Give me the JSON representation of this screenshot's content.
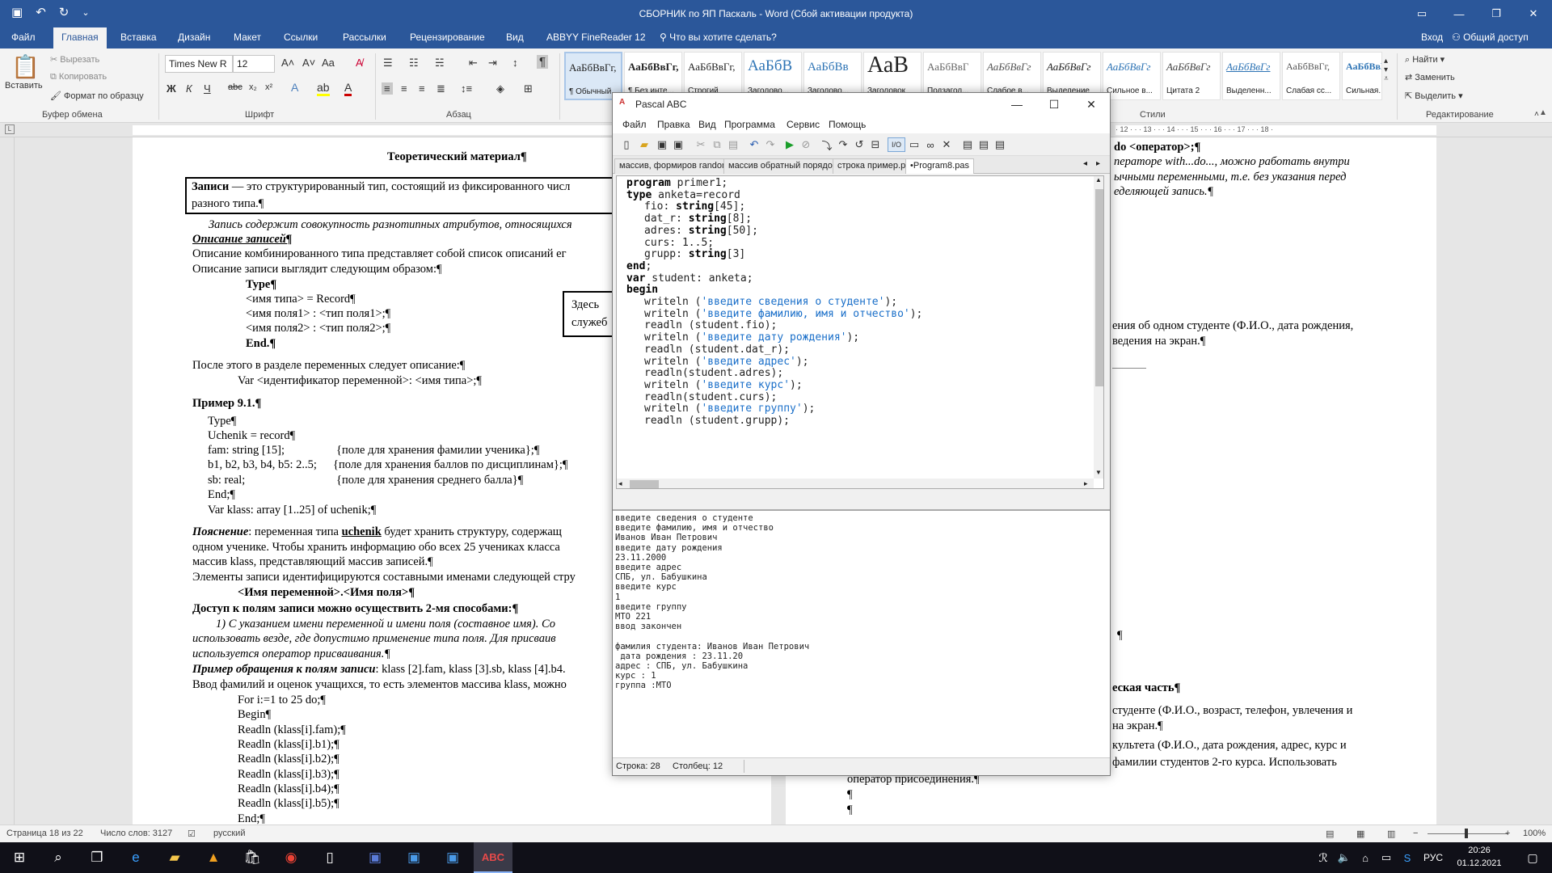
{
  "word": {
    "title": "СБОРНИК по ЯП Паскаль - Word (Сбой активации продукта)",
    "tabs": [
      "Файл",
      "Главная",
      "Вставка",
      "Дизайн",
      "Макет",
      "Ссылки",
      "Рассылки",
      "Рецензирование",
      "Вид",
      "ABBYY FineReader 12"
    ],
    "tell_me": "Что вы хотите сделать?",
    "signin": "Вход",
    "share": "Общий доступ",
    "ribbon": {
      "paste": "Вставить",
      "cut": "Вырезать",
      "copy": "Копировать",
      "format_painter": "Формат по образцу",
      "clipboard_group": "Буфер обмена",
      "font_name": "Times New R",
      "font_size": "12",
      "font_group": "Шрифт",
      "paragraph_group": "Абзац",
      "styles": [
        {
          "sample": "АаБбВвГг,",
          "name": "¶ Обычный"
        },
        {
          "sample": "АаБбВвГг,",
          "name": "¶ Без инте..."
        },
        {
          "sample": "АаБбВвГг,",
          "name": "Строгий"
        },
        {
          "sample": "АаБбВ",
          "name": "Заголово..."
        },
        {
          "sample": "АаБбВв",
          "name": "Заголово..."
        },
        {
          "sample": "АаВ",
          "name": "Заголовок"
        },
        {
          "sample": "АаБбВвГ",
          "name": "Подзагол..."
        },
        {
          "sample": "АаБбВвГг",
          "name": "Слабое в..."
        },
        {
          "sample": "АаБбВвГг",
          "name": "Выделение"
        },
        {
          "sample": "АаБбВвГг",
          "name": "Сильное в..."
        },
        {
          "sample": "АаБбВвГг",
          "name": "Цитата 2"
        },
        {
          "sample": "АаБбВвГг",
          "name": "Выделенн..."
        },
        {
          "sample": "АаБбВвГг,",
          "name": "Слабая сс..."
        },
        {
          "sample": "АаБбВвГг,",
          "name": "Сильная..."
        }
      ],
      "styles_group": "Стили",
      "find": "Найти",
      "replace": "Заменить",
      "select": "Выделить",
      "editing_group": "Редактирование"
    },
    "doc": {
      "heading": "Теоретический материал¶",
      "def1": " — это структурированный тип, состоящий из фиксированного числ",
      "def1_bold": "Записи",
      "def2": "разного типа.¶",
      "l1": "Запись содержит совокупность разнотипных атрибутов, относящихся",
      "l2": "Описание записей¶",
      "l3": "Описание комбинированного типа представляет собой список описаний ег",
      "l4": "Описание записи выглядит следующим образом:¶",
      "l5": "Type¶",
      "l6": "<имя типа> = Record¶",
      "l7": "<имя поля1> : <тип поля1>;¶",
      "l8": "<имя поля2> : <тип поля2>;¶",
      "l9": "End.¶",
      "note1": "Здесь ",
      "note2": "служеб",
      "l10": "После этого в разделе переменных следует описание:¶",
      "l11": "Var <идентификатор переменной>: <имя типа>;¶",
      "l12": "Пример 9.1.¶",
      "l13": "Type¶",
      "l14": "Uchenik = record¶",
      "l15": "fam: string [15];",
      "l15c": "{поле для хранения фамилии ученика};¶",
      "l16": "b1, b2, b3, b4, b5: 2..5;",
      "l16c": "{поле для хранения баллов по дисциплинам};¶",
      "l17": "sb: real;",
      "l17c": "{поле для хранения среднего балла}¶",
      "l18": "End;¶",
      "l19": "Var klass: array [1..25] of uchenik;¶",
      "l20a": "Пояснение",
      "l20b": ": переменная типа ",
      "l20c": "uchenik",
      "l20d": " будет хранить структуру, содержащ",
      "l21": "одном ученике. Чтобы хранить информацию обо всех 25 учениках класса",
      "l22": "массив klass, представляющий массив записей.¶",
      "l23": "Элементы записи идентифицируются составными именами следующей стру",
      "l24": "<Имя переменной>.<Имя поля>¶",
      "l25": "Доступ к полям записи можно осуществить 2-мя способами:¶",
      "l26": "1) С указанием имени переменной и имени поля (составное имя). Со",
      "l27": "использовать везде, где допустимо применение типа поля. Для присваив",
      "l28": "используется оператор присваивания.¶",
      "l29a": "Пример обращения к полям записи",
      "l29b": ": klass [2].fam, klass [3].sb, klass [4].b4.",
      "l30": "Ввод фамилий и оценок учащихся, то есть элементов массива klass, можно",
      "l31": "For i:=1 to 25 do;¶",
      "l32": "Begin¶",
      "l33": "Readln (klass[i].fam);¶",
      "l34": "Readln (klass[i].b1);¶",
      "l35": "Readln (klass[i].b2);¶",
      "l36": "Readln (klass[i].b3);¶",
      "l37": "Readln (klass[i].b4);¶",
      "l38": "Readln (klass[i].b5);¶",
      "l39": "End;¶",
      "r1": "do <оператор>;¶",
      "r2": "ператоре with...do..., можно работать внутри",
      "r3": "ычными переменными, т.е. без указания перед",
      "r4": "еделяющей запись.¶",
      "r5": "ения об одном студенте (Ф.И.О., дата рождения,",
      "r6": "ведения на экран.¶",
      "r7": "¶",
      "r8": "еская часть¶",
      "r9": "студенте (Ф.И.О., возраст, телефон, увлечения и",
      "r10": "на экран.¶",
      "r11": "культета (Ф.И.О., дата рождения, адрес, курс и",
      "r12": "фамилии студентов 2-го курса. Использовать",
      "r13": "оператор присоединения.¶",
      "r14": "¶",
      "r15": "¶"
    },
    "status": {
      "page": "Страница 18 из 22",
      "words": "Число слов: 3127",
      "lang": "русский",
      "zoom": "100%"
    }
  },
  "pascal": {
    "title": "Pascal ABC",
    "menu": [
      "Файл",
      "Правка",
      "Вид",
      "Программа",
      "Сервис",
      "Помощь"
    ],
    "tabs": [
      "массив, формиров random.pas",
      "массив обратный порядок.pas",
      "строка пример.pas",
      "•Program8.pas"
    ],
    "code": [
      {
        "kw": "program",
        "rest": " primer1;",
        "i": 0
      },
      {
        "kw": "type",
        "rest": " anketa=record",
        "i": 0
      },
      {
        "kw": "",
        "rest": "fio: ",
        "kw2": "string",
        "rest2": "[45];",
        "i": 1
      },
      {
        "kw": "",
        "rest": "dat_r: ",
        "kw2": "string",
        "rest2": "[8];",
        "i": 1
      },
      {
        "kw": "",
        "rest": "adres: ",
        "kw2": "string",
        "rest2": "[50];",
        "i": 1
      },
      {
        "kw": "",
        "rest": "curs: 1..5;",
        "i": 1
      },
      {
        "kw": "",
        "rest": "grupp: ",
        "kw2": "string",
        "rest2": "[3]",
        "i": 1
      },
      {
        "kw": "end",
        "rest": ";",
        "i": 0
      },
      {
        "kw": "var",
        "rest": " student: anketa;",
        "i": 0
      },
      {
        "kw": "begin",
        "rest": "",
        "i": 0
      },
      {
        "kw": "",
        "rest": "writeln (",
        "str": "'введите сведения о студенте'",
        "rest2": ");",
        "i": 1
      },
      {
        "kw": "",
        "rest": "writeln (",
        "str": "'введите фамилию, имя и отчество'",
        "rest2": ");",
        "i": 1
      },
      {
        "kw": "",
        "rest": "readln (student.fio);",
        "i": 1
      },
      {
        "kw": "",
        "rest": "writeln (",
        "str": "'введите дату рождения'",
        "rest2": ");",
        "i": 1
      },
      {
        "kw": "",
        "rest": "readln (student.dat_r);",
        "i": 1
      },
      {
        "kw": "",
        "rest": "writeln (",
        "str": "'введите адрес'",
        "rest2": ");",
        "i": 1
      },
      {
        "kw": "",
        "rest": "readln(student.adres);",
        "i": 1
      },
      {
        "kw": "",
        "rest": "writeln (",
        "str": "'введите курс'",
        "rest2": ");",
        "i": 1
      },
      {
        "kw": "",
        "rest": "readln(student.curs);",
        "i": 1
      },
      {
        "kw": "",
        "rest": "writeln (",
        "str": "'введите группу'",
        "rest2": ");",
        "i": 1
      },
      {
        "kw": "",
        "rest": "readln (student.grupp);",
        "i": 1
      }
    ],
    "output": [
      "введите сведения о студенте",
      "введите фамилию, имя и отчество",
      "Иванов Иван Петрович",
      "введите дату рождения",
      "23.11.2000",
      "введите адрес",
      "СПБ, ул. Бабушкина",
      "введите курс",
      "1",
      "введите группу",
      "МТО 221",
      "ввод закончен",
      "",
      "фамилия студента: Иванов Иван Петрович",
      " дата рождения : 23.11.20",
      "адрес : СПБ, ул. Бабушкина",
      "курс : 1",
      "группа :МТО"
    ],
    "status_row": "Строка: 28",
    "status_col": "Столбец: 12"
  },
  "taskbar": {
    "lang": "РУС",
    "time": "20:26",
    "date": "01.12.2021"
  }
}
